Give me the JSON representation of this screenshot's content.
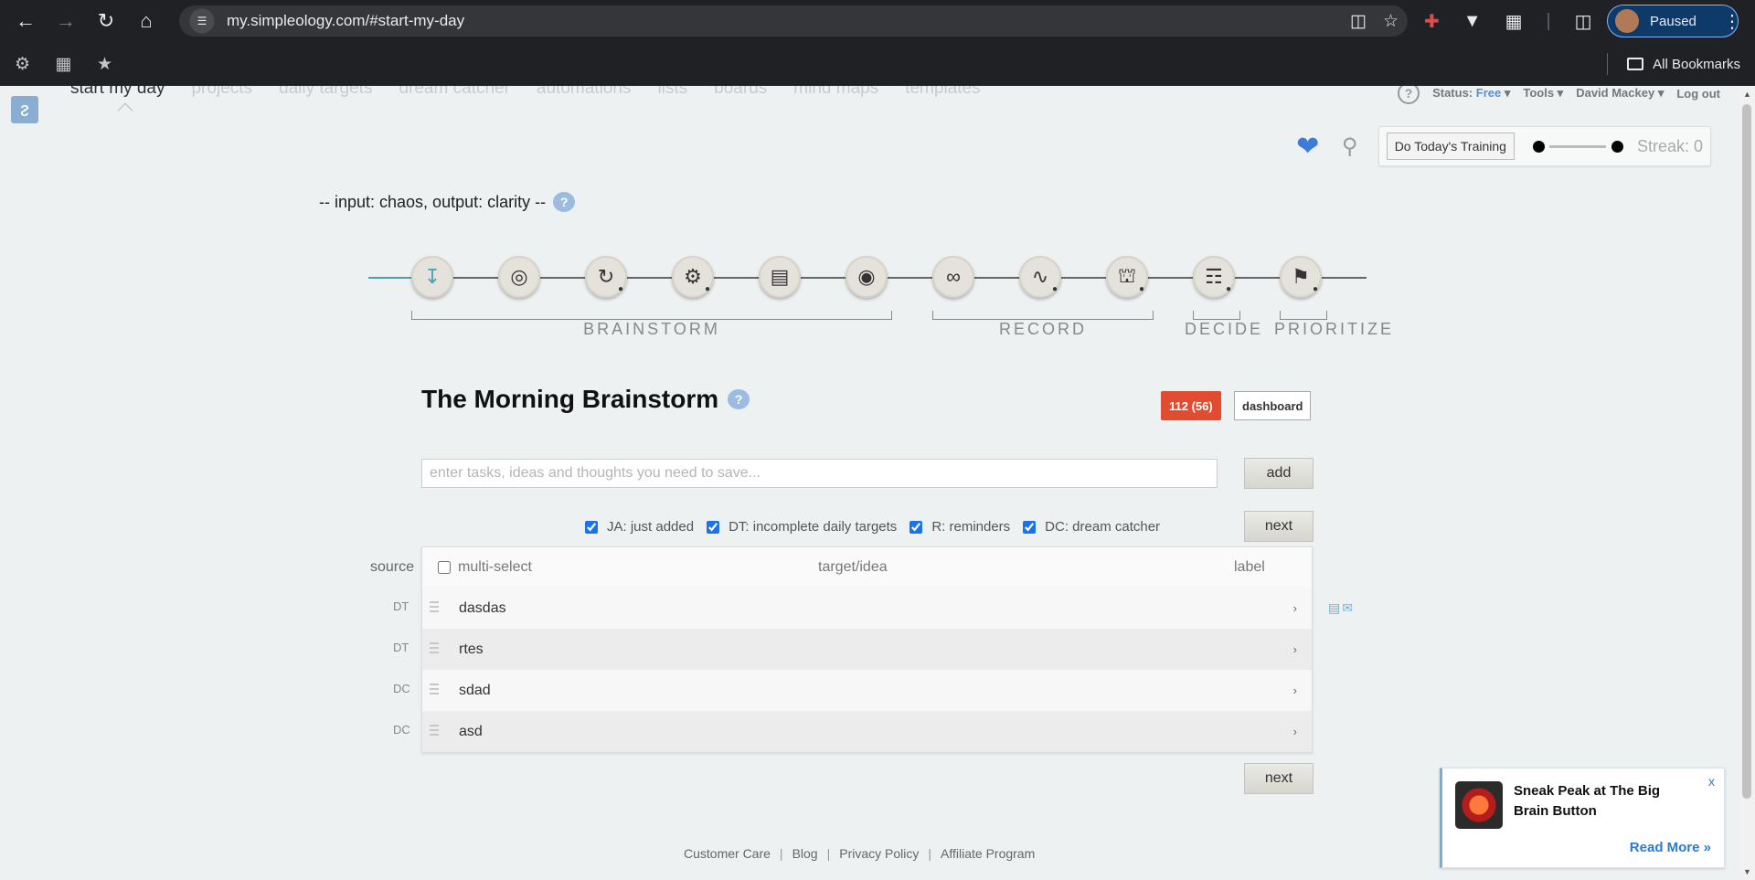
{
  "browser": {
    "url": "my.simpleology.com/#start-my-day",
    "profile_label": "Paused",
    "bookmarks_label": "All Bookmarks"
  },
  "nav": {
    "items": [
      "start my day",
      "projects",
      "daily targets",
      "dream catcher",
      "automations",
      "lists",
      "boards",
      "mind maps",
      "templates"
    ],
    "active": "start my day"
  },
  "status": {
    "status_label": "Status:",
    "status_value": "Free",
    "tools": "Tools",
    "user": "David Mackey",
    "logout": "Log out"
  },
  "toolbar": {
    "training_button": "Do Today's Training",
    "streak": "Streak: 0"
  },
  "tagline": "-- input: chaos, output: clarity --",
  "steps": [
    {
      "icon": "inbox-download-icon",
      "locked": false,
      "active": true
    },
    {
      "icon": "target-icon",
      "locked": false,
      "active": false
    },
    {
      "icon": "refresh-cycle-icon",
      "locked": true,
      "active": false
    },
    {
      "icon": "gears-icon",
      "locked": true,
      "active": false
    },
    {
      "icon": "bar-chart-icon",
      "locked": false,
      "active": false
    },
    {
      "icon": "piggy-bank-icon",
      "locked": false,
      "active": false
    },
    {
      "icon": "loop-arrows-icon",
      "locked": false,
      "active": false
    },
    {
      "icon": "heartbeat-icon",
      "locked": true,
      "active": false
    },
    {
      "icon": "bank-building-icon",
      "locked": true,
      "active": false
    },
    {
      "icon": "candlestick-icon",
      "locked": true,
      "active": false
    },
    {
      "icon": "flag-icon",
      "locked": true,
      "active": false
    }
  ],
  "phases": [
    "BRAINSTORM",
    "RECORD",
    "DECIDE",
    "PRIORITIZE"
  ],
  "section": {
    "title": "The Morning Brainstorm",
    "count_badge": "112 (56)",
    "dashboard_button": "dashboard"
  },
  "input": {
    "placeholder": "enter tasks, ideas and thoughts you need to save...",
    "value": ""
  },
  "add_button": "add",
  "next_button": "next",
  "filters": [
    {
      "label": "JA: just added",
      "checked": true
    },
    {
      "label": "DT: incomplete daily targets",
      "checked": true
    },
    {
      "label": "R: reminders",
      "checked": true
    },
    {
      "label": "DC: dream catcher",
      "checked": true
    }
  ],
  "table": {
    "source_header": "source",
    "multi_select": "multi-select",
    "target_header": "target/idea",
    "label_header": "label",
    "rows": [
      {
        "source": "DT",
        "text": "dasdas"
      },
      {
        "source": "DT",
        "text": "rtes"
      },
      {
        "source": "DC",
        "text": "sdad"
      },
      {
        "source": "DC",
        "text": "asd"
      }
    ]
  },
  "footer": [
    "Customer Care",
    "Blog",
    "Privacy Policy",
    "Affiliate Program"
  ],
  "promo": {
    "title": "Sneak Peak at The Big Brain Button",
    "close": "x",
    "link": "Read More »"
  }
}
